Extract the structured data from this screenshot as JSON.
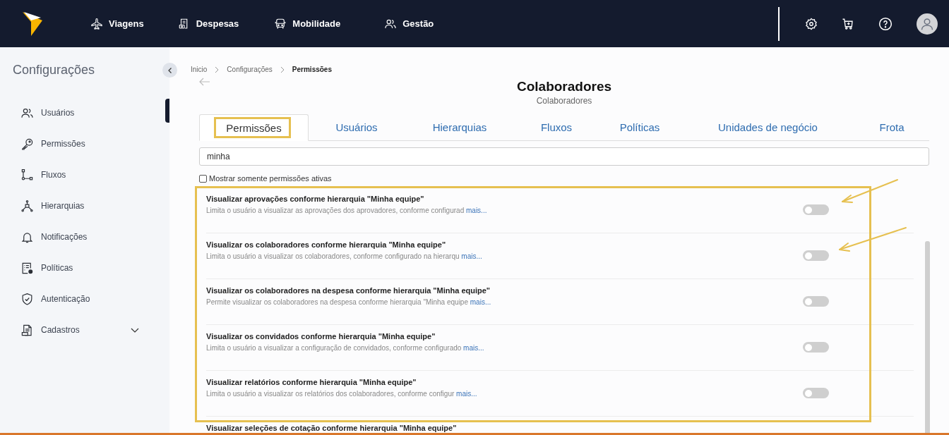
{
  "header": {
    "nav": [
      {
        "label": "Viagens",
        "kind": "plane"
      },
      {
        "label": "Despesas",
        "kind": "receipt"
      },
      {
        "label": "Mobilidade",
        "kind": "bus"
      },
      {
        "label": "Gestão",
        "kind": "users"
      }
    ]
  },
  "sidebar": {
    "title": "Configurações",
    "items": [
      {
        "label": "Usuários",
        "kind": "users"
      },
      {
        "label": "Permissões",
        "kind": "key"
      },
      {
        "label": "Fluxos",
        "kind": "flow"
      },
      {
        "label": "Hierarquias",
        "kind": "hierarchy"
      },
      {
        "label": "Notificações",
        "kind": "bell"
      },
      {
        "label": "Políticas",
        "kind": "policy"
      },
      {
        "label": "Autenticação",
        "kind": "shield"
      },
      {
        "label": "Cadastros",
        "kind": "document",
        "expanded": false
      }
    ]
  },
  "breadcrumb": [
    {
      "label": "Inicio",
      "current": false
    },
    {
      "label": "Configurações",
      "current": false
    },
    {
      "label": "Permissões",
      "current": true
    }
  ],
  "page": {
    "title": "Colaboradores",
    "subtitle": "Colaboradores"
  },
  "tabs": [
    {
      "label": "Permissões",
      "selected": true
    },
    {
      "label": "Usuários",
      "selected": false
    },
    {
      "label": "Hierarquias",
      "selected": false
    },
    {
      "label": "Fluxos",
      "selected": false
    },
    {
      "label": "Políticas",
      "selected": false
    },
    {
      "label": "Unidades de negócio",
      "selected": false
    },
    {
      "label": "Frota",
      "selected": false
    }
  ],
  "search": {
    "value": "minha"
  },
  "filter": {
    "label": "Mostrar somente permissões ativas",
    "checked": false
  },
  "permissions": [
    {
      "title": "Visualizar aprovações conforme hierarquia \"Minha equipe\"",
      "description": "Limita o usuário a visualizar as aprovações dos aprovadores, conforme configurad",
      "more": "mais...",
      "on": false
    },
    {
      "title": "Visualizar os colaboradores conforme hierarquia \"Minha equipe\"",
      "description": "Limita o usuário a visualizar os colaboradores, conforme configurado na hierarqu",
      "more": "mais...",
      "on": false
    },
    {
      "title": "Visualizar os colaboradores na despesa conforme hierarquia \"Minha equipe\"",
      "description": "Permite visualizar os colaboradores na despesa conforme hierarquia \"Minha equipe",
      "more": "mais...",
      "on": false
    },
    {
      "title": "Visualizar os convidados conforme hierarquia \"Minha equipe\"",
      "description": "Limita o usuário a visualizar a configuração de convidados, conforme configurado",
      "more": "mais...",
      "on": false
    },
    {
      "title": "Visualizar relatórios conforme hierarquia \"Minha equipe\"",
      "description": "Limita o usuário a visualizar os relatórios dos colaboradores, conforme configur",
      "more": "mais...",
      "on": false
    },
    {
      "title": "Visualizar seleções de cotação conforme hierarquia \"Minha equipe\""
    }
  ]
}
